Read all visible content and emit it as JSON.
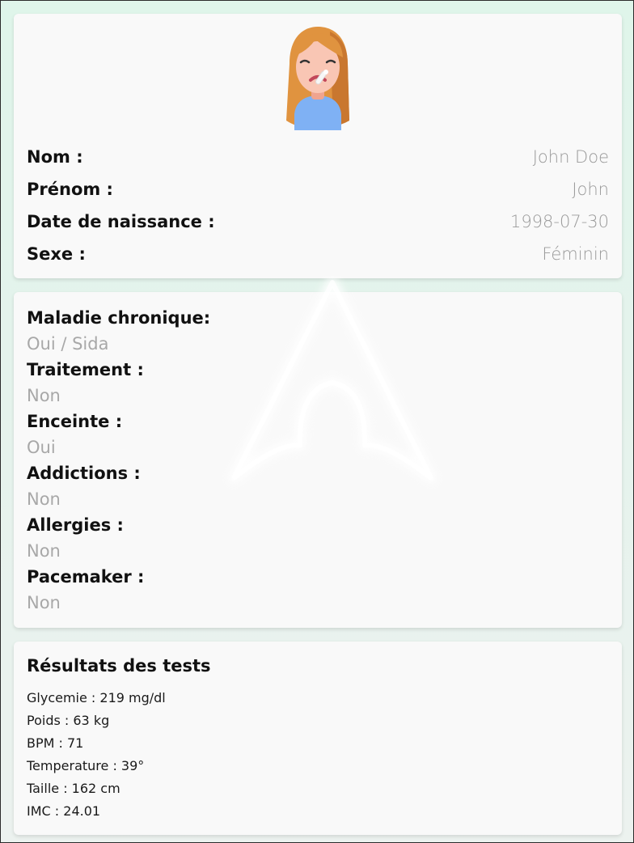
{
  "profile": {
    "avatar_icon": "sick-woman-avatar-icon",
    "rows": [
      {
        "label": "Nom :",
        "value": "John Doe"
      },
      {
        "label": "Prénom :",
        "value": "John"
      },
      {
        "label": "Date de naissance :",
        "value": "1998-07-30"
      },
      {
        "label": "Sexe :",
        "value": "Féminin"
      }
    ]
  },
  "medical": {
    "items": [
      {
        "label": "Maladie chronique:",
        "value": "Oui / Sida"
      },
      {
        "label": "Traitement :",
        "value": "Non"
      },
      {
        "label": "Enceinte :",
        "value": "Oui"
      },
      {
        "label": "Addictions :",
        "value": "Non"
      },
      {
        "label": "Allergies :",
        "value": "Non"
      },
      {
        "label": "Pacemaker :",
        "value": "Non"
      }
    ]
  },
  "tests": {
    "title": "Résultats des tests",
    "items": [
      "Glycemie : 219 mg/dl",
      "Poids : 63 kg",
      "BPM : 71",
      "Temperature : 39°",
      "Taille : 162 cm",
      "IMC : 24.01"
    ]
  },
  "colors": {
    "background": "#e4f3ec",
    "card": "#f9f9f9",
    "label": "#111111",
    "value": "#9a9a9a"
  },
  "watermark_icon": "arch-logo-watermark-icon"
}
